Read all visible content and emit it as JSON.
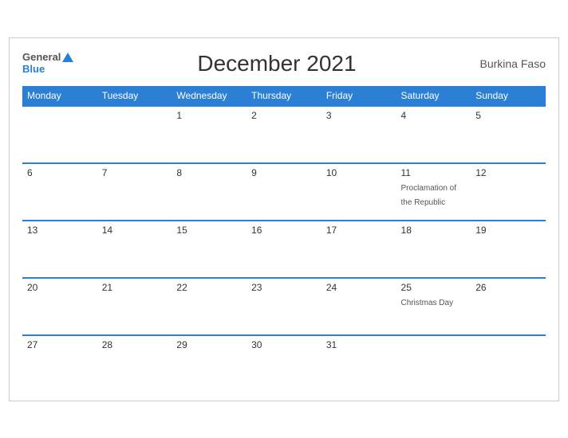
{
  "logo": {
    "line1": "General",
    "line2": "Blue"
  },
  "header": {
    "title": "December 2021",
    "country": "Burkina Faso"
  },
  "weekdays": [
    "Monday",
    "Tuesday",
    "Wednesday",
    "Thursday",
    "Friday",
    "Saturday",
    "Sunday"
  ],
  "weeks": [
    [
      {
        "day": "",
        "empty": true
      },
      {
        "day": "",
        "empty": true
      },
      {
        "day": "1",
        "empty": false,
        "holiday": ""
      },
      {
        "day": "2",
        "empty": false,
        "holiday": ""
      },
      {
        "day": "3",
        "empty": false,
        "holiday": ""
      },
      {
        "day": "4",
        "empty": false,
        "holiday": ""
      },
      {
        "day": "5",
        "empty": false,
        "holiday": ""
      }
    ],
    [
      {
        "day": "6",
        "empty": false,
        "holiday": ""
      },
      {
        "day": "7",
        "empty": false,
        "holiday": ""
      },
      {
        "day": "8",
        "empty": false,
        "holiday": ""
      },
      {
        "day": "9",
        "empty": false,
        "holiday": ""
      },
      {
        "day": "10",
        "empty": false,
        "holiday": ""
      },
      {
        "day": "11",
        "empty": false,
        "holiday": "Proclamation of the Republic"
      },
      {
        "day": "12",
        "empty": false,
        "holiday": ""
      }
    ],
    [
      {
        "day": "13",
        "empty": false,
        "holiday": ""
      },
      {
        "day": "14",
        "empty": false,
        "holiday": ""
      },
      {
        "day": "15",
        "empty": false,
        "holiday": ""
      },
      {
        "day": "16",
        "empty": false,
        "holiday": ""
      },
      {
        "day": "17",
        "empty": false,
        "holiday": ""
      },
      {
        "day": "18",
        "empty": false,
        "holiday": ""
      },
      {
        "day": "19",
        "empty": false,
        "holiday": ""
      }
    ],
    [
      {
        "day": "20",
        "empty": false,
        "holiday": ""
      },
      {
        "day": "21",
        "empty": false,
        "holiday": ""
      },
      {
        "day": "22",
        "empty": false,
        "holiday": ""
      },
      {
        "day": "23",
        "empty": false,
        "holiday": ""
      },
      {
        "day": "24",
        "empty": false,
        "holiday": ""
      },
      {
        "day": "25",
        "empty": false,
        "holiday": "Christmas Day"
      },
      {
        "day": "26",
        "empty": false,
        "holiday": ""
      }
    ],
    [
      {
        "day": "27",
        "empty": false,
        "holiday": ""
      },
      {
        "day": "28",
        "empty": false,
        "holiday": ""
      },
      {
        "day": "29",
        "empty": false,
        "holiday": ""
      },
      {
        "day": "30",
        "empty": false,
        "holiday": ""
      },
      {
        "day": "31",
        "empty": false,
        "holiday": ""
      },
      {
        "day": "",
        "empty": true
      },
      {
        "day": "",
        "empty": true
      }
    ]
  ]
}
